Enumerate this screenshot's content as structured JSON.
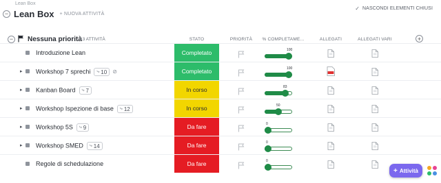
{
  "breadcrumb": "Lean Box",
  "page_title": "Lean Box",
  "new_task_label": "+ NUOVA ATTIVITÀ",
  "hide_closed_label": "NASCONDI ELEMENTI CHIUSI",
  "group": {
    "name": "Nessuna priorità",
    "count": "13 ATTIVITÀ"
  },
  "columns": {
    "status": "STATO",
    "priority": "PRIORITÀ",
    "progress": "% COMPLETAME...",
    "attachments": "ALLEGATI",
    "misc_attachments": "ALLEGATI VARI"
  },
  "colors": {
    "done": "#2dbc6a",
    "in_progress": "#f2d600",
    "todo": "#e51c23",
    "progress": "#1f8b47",
    "accent": "#7b68ee"
  },
  "tasks": [
    {
      "name": "Introduzione Lean",
      "subtasks": "",
      "status": "Completato",
      "status_kind": "done",
      "progress": 100,
      "has_expander": false,
      "attachment": "file-icon"
    },
    {
      "name": "Workshop 7 sprechi",
      "subtasks": "10",
      "status": "Completato",
      "status_kind": "done",
      "progress": 100,
      "has_expander": true,
      "attachment": "pdf-icon"
    },
    {
      "name": "Kanban Board",
      "subtasks": "7",
      "status": "In corso",
      "status_kind": "in_progress",
      "progress": 83,
      "has_expander": true,
      "attachment": "file-icon"
    },
    {
      "name": "Workshop Ispezione di base",
      "subtasks": "12",
      "status": "In corso",
      "status_kind": "in_progress",
      "progress": 50,
      "has_expander": true,
      "attachment": "file-icon"
    },
    {
      "name": "Workshop 5S",
      "subtasks": "9",
      "status": "Da fare",
      "status_kind": "todo",
      "progress": 0,
      "has_expander": true,
      "attachment": "file-icon"
    },
    {
      "name": "Workshop SMED",
      "subtasks": "14",
      "status": "Da fare",
      "status_kind": "todo",
      "progress": 0,
      "has_expander": true,
      "attachment": "file-icon"
    },
    {
      "name": "Regole di schedulazione",
      "subtasks": "",
      "status": "Da fare",
      "status_kind": "todo",
      "progress": 0,
      "has_expander": false,
      "attachment": "file-icon"
    }
  ],
  "fab_label": "Attività"
}
